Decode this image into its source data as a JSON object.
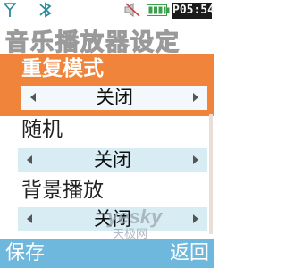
{
  "status": {
    "clock": "P05:54"
  },
  "title": "音乐播放器设定",
  "settings": [
    {
      "label": "重复模式",
      "value": "关闭"
    },
    {
      "label": "随机",
      "value": "关闭"
    },
    {
      "label": "背景播放",
      "value": "关闭"
    }
  ],
  "softkeys": {
    "left": "保存",
    "right": "返回"
  },
  "watermark": {
    "text": "yesky",
    "subtext": "天极网"
  },
  "colors": {
    "accent": "#f0843a",
    "softkey_bar": "#6fb8dd",
    "value_bg": "#d8ecf4"
  }
}
